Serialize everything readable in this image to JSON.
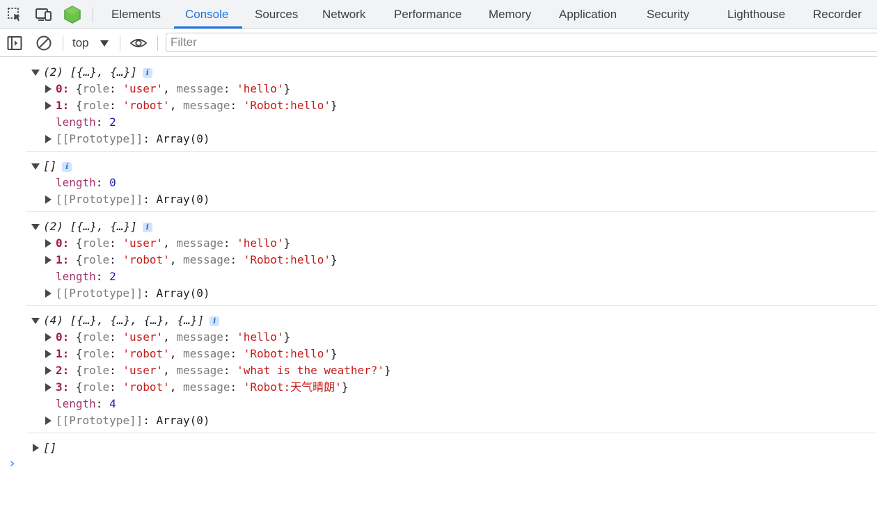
{
  "tabs": [
    "Elements",
    "Console",
    "Sources",
    "Network",
    "Performance",
    "Memory",
    "Application",
    "Security",
    "Lighthouse",
    "Recorder"
  ],
  "active_tab": "Console",
  "toolbar": {
    "context": "top",
    "filter_placeholder": "Filter"
  },
  "colors": {
    "accent": "#1a73e8",
    "string": "#c41a16",
    "number": "#1a1aa6",
    "key": "#9e1a54"
  },
  "icons": [
    "inspect-element-icon",
    "device-toolbar-icon",
    "node-icon",
    "sidebar-toggle-icon",
    "clear-console-icon",
    "eye-icon"
  ],
  "console": {
    "messages": [
      {
        "summary": "(2) [{…}, {…}]",
        "expanded": true,
        "items": [
          {
            "index": "0",
            "role": "'user'",
            "message": "'hello'"
          },
          {
            "index": "1",
            "role": "'robot'",
            "message": "'Robot:hello'"
          }
        ],
        "length": "2",
        "prototype": "Array(0)"
      },
      {
        "summary": "[]",
        "expanded": true,
        "items": [],
        "length": "0",
        "prototype": "Array(0)"
      },
      {
        "summary": "(2) [{…}, {…}]",
        "expanded": true,
        "items": [
          {
            "index": "0",
            "role": "'user'",
            "message": "'hello'"
          },
          {
            "index": "1",
            "role": "'robot'",
            "message": "'Robot:hello'"
          }
        ],
        "length": "2",
        "prototype": "Array(0)"
      },
      {
        "summary": "(4) [{…}, {…}, {…}, {…}]",
        "expanded": true,
        "items": [
          {
            "index": "0",
            "role": "'user'",
            "message": "'hello'"
          },
          {
            "index": "1",
            "role": "'robot'",
            "message": "'Robot:hello'"
          },
          {
            "index": "2",
            "role": "'user'",
            "message": "'what is the weather?'"
          },
          {
            "index": "3",
            "role": "'robot'",
            "message": "'Robot:天气晴朗'"
          }
        ],
        "length": "4",
        "prototype": "Array(0)"
      },
      {
        "summary": "[]",
        "expanded": false
      }
    ],
    "labels": {
      "role": "role",
      "message": "message",
      "length": "length",
      "prototype": "[[Prototype]]"
    },
    "prompt": "›"
  }
}
